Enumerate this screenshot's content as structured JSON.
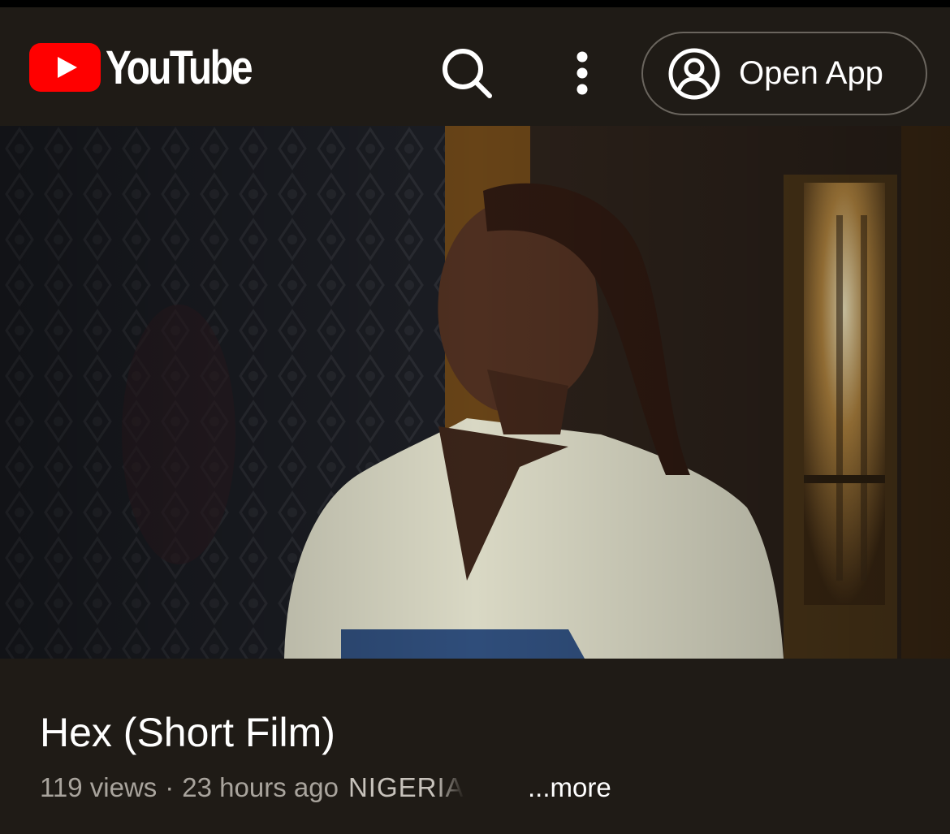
{
  "header": {
    "logo_text": "YouTube",
    "search_icon": "search-icon",
    "more_icon": "more-vert-icon",
    "open_app_label": "Open App",
    "account_icon": "account-circle-icon",
    "brand_color": "#ff0000"
  },
  "video": {
    "title": "Hex (Short Film)",
    "views": "119 views",
    "separator": "·",
    "age": "23 hours ago",
    "location": "NIGERIA",
    "more_label": "...more"
  }
}
